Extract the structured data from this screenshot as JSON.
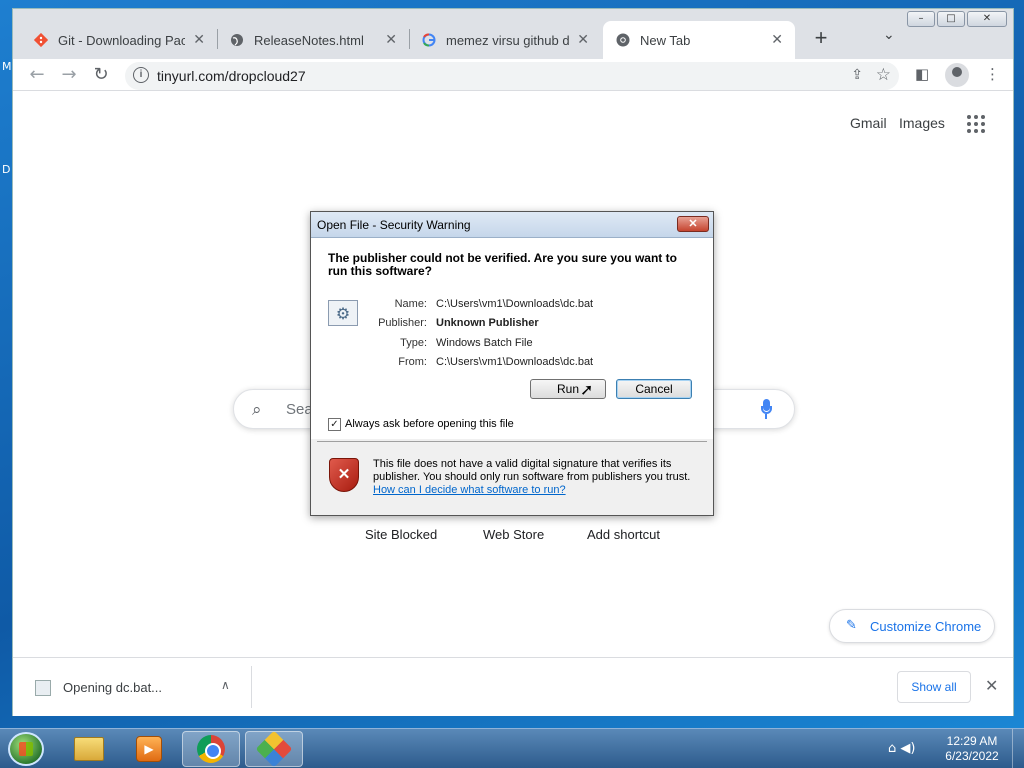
{
  "desktop": {
    "letters": [
      "M",
      "D"
    ]
  },
  "window_controls": {
    "minimize": "–",
    "maximize": "□",
    "close": "✕"
  },
  "tabs": [
    {
      "title": "Git - Downloading Package",
      "icon": "git-icon",
      "close": "✕"
    },
    {
      "title": "ReleaseNotes.html",
      "icon": "globe-icon",
      "close": "✕"
    },
    {
      "title": "memez virsu github dov",
      "icon": "google-icon",
      "close": "✕"
    },
    {
      "title": "New Tab",
      "icon": "chrome-icon",
      "close": "✕"
    }
  ],
  "new_tab_glyph": "+",
  "tab_search_glyph": "⌄",
  "toolbar": {
    "back": "←",
    "forward": "→",
    "reload": "↻",
    "url": "tinyurl.com/dropcloud27",
    "info_glyph": "i",
    "share_glyph": "⇪",
    "star_glyph": "☆",
    "sidebar_glyph": "◧",
    "menu_glyph": "⋮"
  },
  "ntp": {
    "gmail": "Gmail",
    "images": "Images",
    "search_placeholder": "Sea",
    "search_glyph": "⌕",
    "shortcuts": [
      "Site Blocked",
      "Web Store",
      "Add shortcut"
    ],
    "customize_label": "Customize Chrome",
    "customize_glyph": "✎"
  },
  "dialog": {
    "title": "Open File - Security Warning",
    "close_glyph": "✕",
    "question": "The publisher could not be verified.  Are you sure you want to run this software?",
    "fields": [
      {
        "label": "Name:",
        "value": "C:\\Users\\vm1\\Downloads\\dc.bat"
      },
      {
        "label": "Publisher:",
        "value": "Unknown Publisher"
      },
      {
        "label": "Type:",
        "value": "Windows Batch File"
      },
      {
        "label": "From:",
        "value": "C:\\Users\\vm1\\Downloads\\dc.bat"
      }
    ],
    "run_label": "Run",
    "cancel_label": "Cancel",
    "checkbox_label": "Always ask before opening this file",
    "checkbox_checked": true,
    "checkbox_glyph": "✓",
    "warning_text": "This file does not have a valid digital signature that verifies its publisher.  You should only run software from publishers you trust.",
    "warning_link": "How can I decide what software to run?",
    "shield_glyph": "✕"
  },
  "download_shelf": {
    "filename": "Opening dc.bat...",
    "chevron": "∧",
    "show_all": "Show all",
    "close": "✕"
  },
  "taskbar": {
    "tray_glyphs": "⌂ ◀)",
    "time": "12:29 AM",
    "date": "6/23/2022",
    "media_glyph": "▶"
  },
  "colors": {
    "link_blue": "#1a73e8",
    "dialog_title_bg": "#c5d6ea",
    "taskbar": "#2d5b8c"
  }
}
